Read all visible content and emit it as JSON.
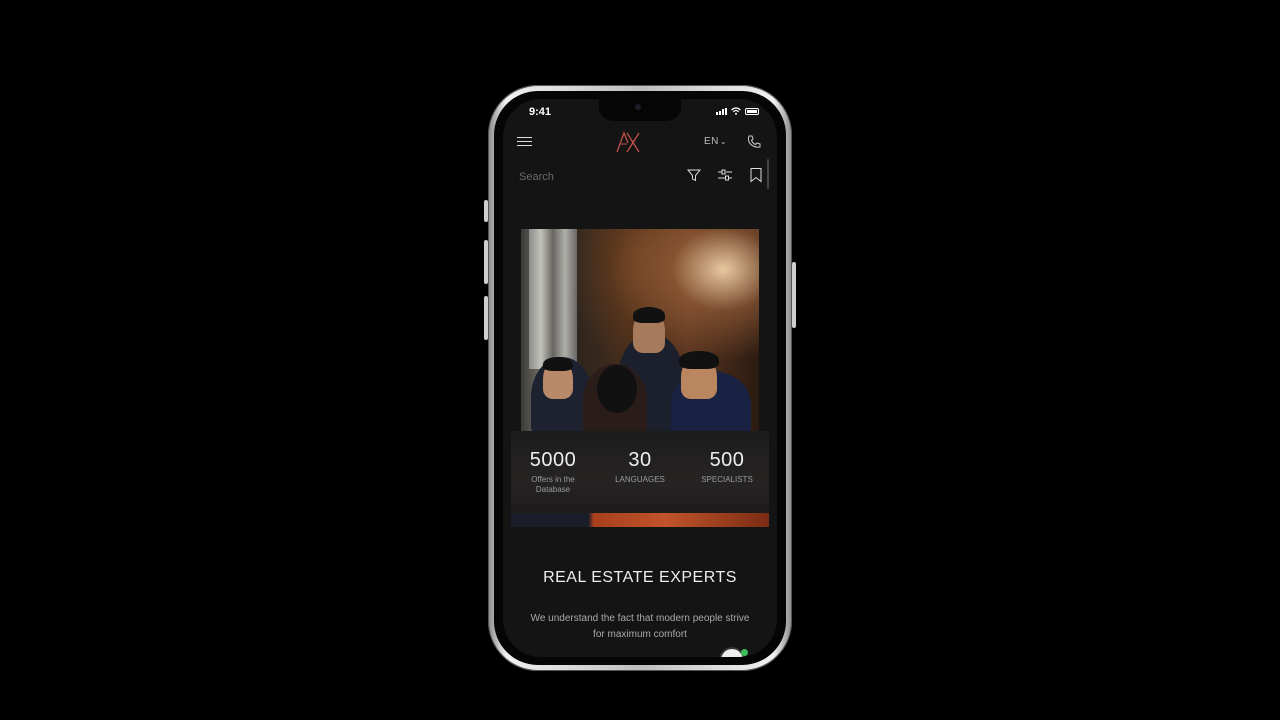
{
  "status_bar": {
    "time": "9:41"
  },
  "header": {
    "logo_alt": "AX logo",
    "language": "EN"
  },
  "search": {
    "placeholder": "Search"
  },
  "stats": [
    {
      "value": "5000",
      "label": "Offers in the Database"
    },
    {
      "value": "30",
      "label": "LANGUAGES"
    },
    {
      "value": "500",
      "label": "SPECIALISTS"
    }
  ],
  "section": {
    "title": "REAL ESTATE EXPERTS",
    "text": "We understand the fact that modern people strive for maximum comfort"
  },
  "colors": {
    "background": "#000000",
    "screen": "#151414",
    "logo_accent": "#c0504a",
    "strip_accent": "#c0542a",
    "online_dot": "#3cbf5a"
  },
  "icons": [
    "menu-icon",
    "ax-logo",
    "chevron-down-icon",
    "phone-icon",
    "filter-icon",
    "sliders-icon",
    "bookmark-icon",
    "chat-avatar-icon"
  ]
}
